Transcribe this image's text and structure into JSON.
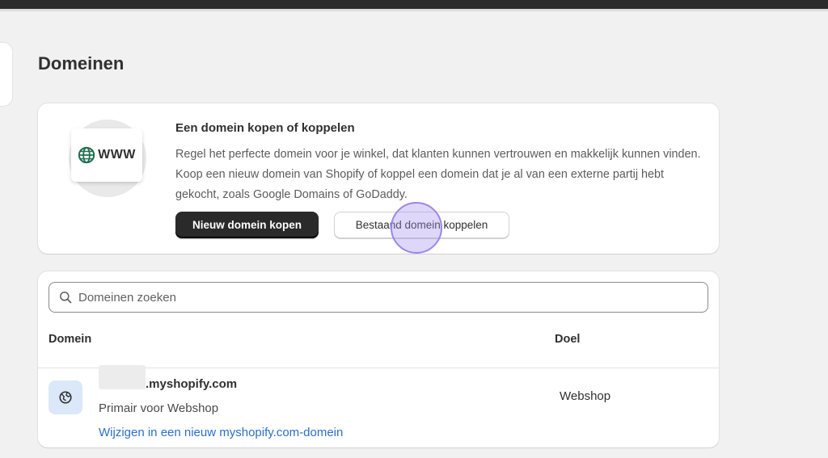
{
  "page": {
    "title": "Domeinen"
  },
  "promo": {
    "title": "Een domein kopen of koppelen",
    "description": "Regel het perfecte domein voor je winkel, dat klanten kunnen vertrouwen en makkelijk kunnen vinden. Koop een nieuw domein van Shopify of koppel een domein dat je al van een externe partij hebt gekocht, zoals Google Domains of GoDaddy.",
    "illustration_text": "WWW",
    "illustration_icon": "globe-icon",
    "primary_button": "Nieuw domein kopen",
    "secondary_button": "Bestaand domein koppelen"
  },
  "search": {
    "placeholder": "Domeinen zoeken",
    "icon": "search-icon"
  },
  "table": {
    "columns": [
      "Domein",
      "Doel"
    ],
    "rows": [
      {
        "icon": "globe-icon",
        "domain": ".myshopify.com",
        "subtitle": "Primair voor Webshop",
        "link": "Wijzigen in een nieuw myshopify.com-domein",
        "purpose": "Webshop"
      }
    ]
  },
  "colors": {
    "primary_button": "#2a2a2a",
    "link": "#2c6ecb",
    "icon_bg": "#dbe8f9",
    "globe": "#1f6f52",
    "click_indicator": "#9a86ef"
  }
}
